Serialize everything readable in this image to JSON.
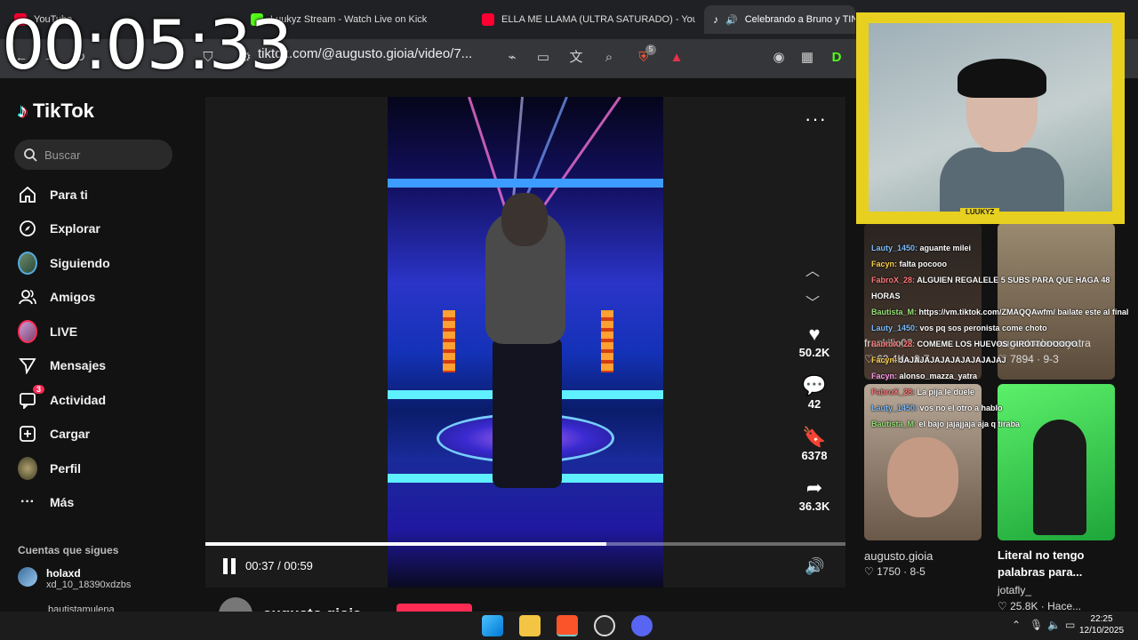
{
  "timer": "00:05:33",
  "browser": {
    "tabs": [
      {
        "label": "YouTube",
        "color": "#ff0033",
        "active": false
      },
      {
        "label": "Luukyz Stream - Watch Live on Kick",
        "color": "#53fc18",
        "active": false
      },
      {
        "label": "ELLA ME LLAMA (ULTRA SATURADO) - YouTube",
        "color": "#ff0033",
        "active": false
      },
      {
        "label": "Celebrando a Bruno y TINI",
        "color": "#ffffff",
        "active": true
      }
    ],
    "url": "tiktok.com/@augusto.gioia/video/7...",
    "shield_badge": "5"
  },
  "tiktok": {
    "logo": "TikTok",
    "search_placeholder": "Buscar",
    "nav": [
      {
        "label": "Para ti",
        "icon": "home-icon"
      },
      {
        "label": "Explorar",
        "icon": "compass-icon"
      },
      {
        "label": "Siguiendo",
        "icon": "following-avatar"
      },
      {
        "label": "Amigos",
        "icon": "friends-icon"
      },
      {
        "label": "LIVE",
        "icon": "live-avatar"
      },
      {
        "label": "Mensajes",
        "icon": "send-icon"
      },
      {
        "label": "Actividad",
        "icon": "inbox-icon",
        "badge": "3"
      },
      {
        "label": "Cargar",
        "icon": "plus-icon"
      },
      {
        "label": "Perfil",
        "icon": "profile-avatar"
      },
      {
        "label": "Más",
        "icon": "more-icon"
      }
    ],
    "following_title": "Cuentas que sigues",
    "following": [
      {
        "name": "holaxd",
        "sub": "xd_10_18390xdzbs"
      },
      {
        "name": "bautistamulena",
        "sub": ""
      }
    ],
    "player": {
      "time": "00:37 / 00:59",
      "progress": 0.627,
      "author": "augusto.gioia",
      "likes": "50.2K",
      "comments": "42",
      "saves": "6378",
      "shares": "36.3K"
    },
    "related": [
      {
        "user": "frankilio02",
        "likes": "62.4K",
        "date": "9-7",
        "title": ""
      },
      {
        "user": "augustoalonsoyatra",
        "likes": "7894",
        "date": "9-3",
        "title": ""
      },
      {
        "user": "augusto.gioia",
        "likes": "1750",
        "date": "8-5",
        "title": ""
      },
      {
        "user": "jotafly_",
        "likes": "25.8K",
        "date": "Hace...",
        "title": "Literal no tengo palabras para..."
      }
    ]
  },
  "webcam": {
    "label": "LUUKYZ"
  },
  "chat": [
    {
      "user": "Lauty_1450:",
      "msg": "aguante milei",
      "cls": "u1"
    },
    {
      "user": "Facyn:",
      "msg": "falta pocooo",
      "cls": "u3"
    },
    {
      "user": "FabroX_28:",
      "msg": "ALGUIEN REGALELE 5 SUBS PARA QUE HAGA 48 HORAS",
      "cls": "u2"
    },
    {
      "user": "Bautista_M:",
      "msg": "https://vm.tiktok.com/ZMAQQAwfm/ bailate este al final",
      "cls": "u4"
    },
    {
      "user": "Lauty_1450:",
      "msg": "vos pq sos peronista come choto",
      "cls": "u1"
    },
    {
      "user": "FabroX_28:",
      "msg": "COMEME LOS HUEVOS GIROTTOOOOOO",
      "cls": "u2"
    },
    {
      "user": "Facyn:",
      "msg": "JAJAJAJAJAJAJAJAJAJAJ",
      "cls": "u3"
    },
    {
      "user": "Facyn:",
      "msg": "alonso_mazza_yatra",
      "cls": "u5"
    },
    {
      "user": "FabroX_28:",
      "msg": "La pija le duele",
      "cls": "u2"
    },
    {
      "user": "Lauty_1450:",
      "msg": "vos no el otro a hablo",
      "cls": "u1"
    },
    {
      "user": "Bautista_M:",
      "msg": "el bajo jajajjaja aja q tiraba",
      "cls": "u4"
    }
  ],
  "taskbar": {
    "time": "22:25",
    "date": "12/10/2025"
  },
  "colors": {
    "accent": "#fe2c55",
    "webcam_frame": "#e8d020"
  }
}
